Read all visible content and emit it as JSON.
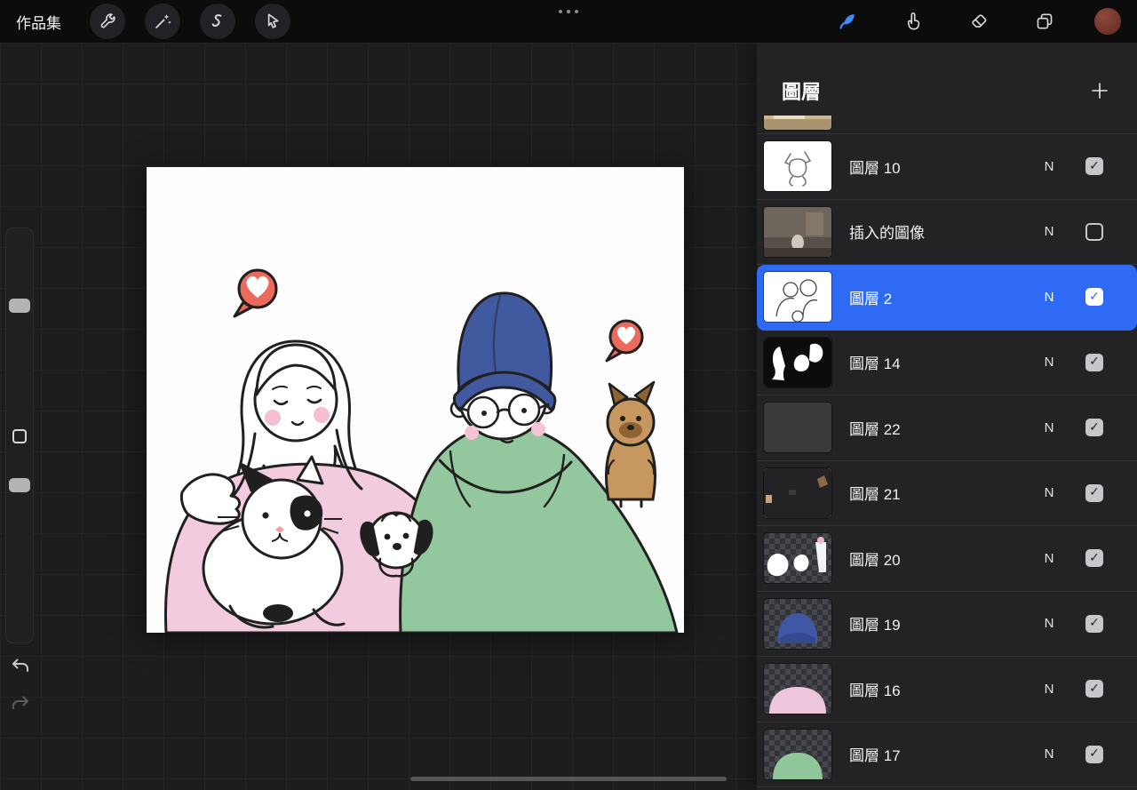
{
  "top_bar": {
    "gallery_label": "作品集",
    "left_icons": [
      "wrench-icon",
      "magic-wand-icon",
      "selection-s-icon",
      "transform-arrow-icon"
    ],
    "right_icons": [
      "brush-icon",
      "smudge-icon",
      "eraser-icon",
      "layers-icon",
      "color-swatch"
    ],
    "active_tool": "brush",
    "active_tool_color": "#3c8bff",
    "color_swatch_color": "#7b3b31"
  },
  "layers_panel": {
    "title": "圖層",
    "selected_color": "#2e6af3",
    "items": [
      {
        "name": "圖層 10",
        "blend": "N",
        "visible": true,
        "selected": false
      },
      {
        "name": "插入的圖像",
        "blend": "N",
        "visible": false,
        "selected": false
      },
      {
        "name": "圖層 2",
        "blend": "N",
        "visible": true,
        "selected": true
      },
      {
        "name": "圖層 14",
        "blend": "N",
        "visible": true,
        "selected": false
      },
      {
        "name": "圖層 22",
        "blend": "N",
        "visible": true,
        "selected": false
      },
      {
        "name": "圖層 21",
        "blend": "N",
        "visible": true,
        "selected": false
      },
      {
        "name": "圖層 20",
        "blend": "N",
        "visible": true,
        "selected": false
      },
      {
        "name": "圖層 19",
        "blend": "N",
        "visible": true,
        "selected": false
      },
      {
        "name": "圖層 16",
        "blend": "N",
        "visible": true,
        "selected": false
      },
      {
        "name": "圖層 17",
        "blend": "N",
        "visible": true,
        "selected": false
      }
    ]
  },
  "artwork_colors": {
    "sweater_pink": "#f3cbdf",
    "hoodie_green": "#93c89e",
    "beanie_blue": "#41599e",
    "heart_red": "#ec6a5c",
    "yorkie_brown": "#c6975e"
  }
}
